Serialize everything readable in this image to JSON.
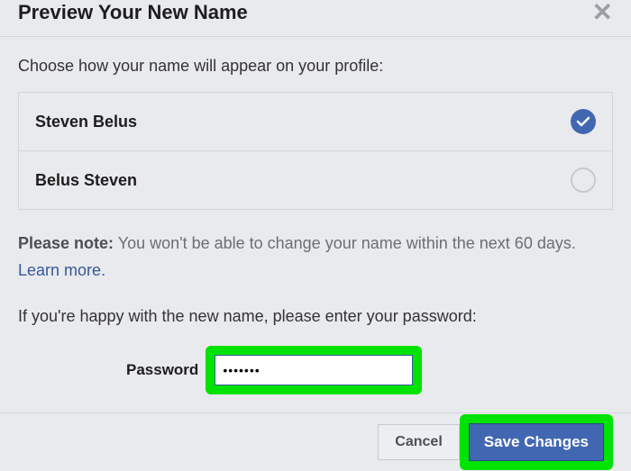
{
  "header": {
    "title": "Preview Your New Name"
  },
  "body": {
    "choose_text": "Choose how your name will appear on your profile:",
    "options": [
      {
        "label": "Steven Belus",
        "selected": true
      },
      {
        "label": "Belus Steven",
        "selected": false
      }
    ],
    "note_bold": "Please note:",
    "note_text": "You won't be able to change your name within the next 60 days.",
    "learn_more": "Learn more",
    "happy_text": "If you're happy with the new name, please enter your password:",
    "password_label": "Password",
    "password_value": "•••••••"
  },
  "footer": {
    "cancel": "Cancel",
    "save": "Save Changes"
  }
}
